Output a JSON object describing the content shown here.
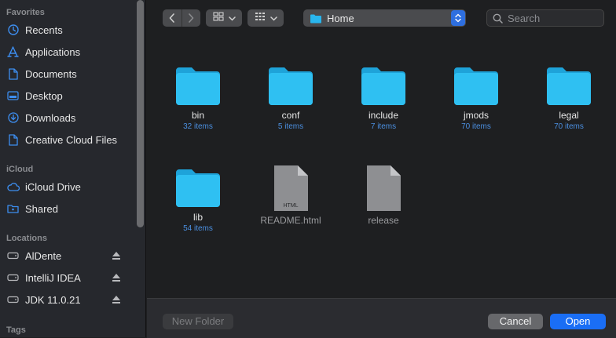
{
  "sidebar": {
    "favorites_label": "Favorites",
    "favorites": [
      {
        "label": "Recents",
        "icon": "clock-icon"
      },
      {
        "label": "Applications",
        "icon": "applications-icon"
      },
      {
        "label": "Documents",
        "icon": "document-icon"
      },
      {
        "label": "Desktop",
        "icon": "desktop-icon"
      },
      {
        "label": "Downloads",
        "icon": "download-icon"
      },
      {
        "label": "Creative Cloud Files",
        "icon": "file-icon"
      }
    ],
    "icloud_label": "iCloud",
    "icloud": [
      {
        "label": "iCloud Drive",
        "icon": "cloud-icon"
      },
      {
        "label": "Shared",
        "icon": "shared-folder-icon"
      }
    ],
    "locations_label": "Locations",
    "locations": [
      {
        "label": "AlDente",
        "icon": "drive-icon"
      },
      {
        "label": "IntelliJ IDEA",
        "icon": "drive-icon"
      },
      {
        "label": "JDK 11.0.21",
        "icon": "drive-icon"
      }
    ],
    "tags_label": "Tags",
    "accent_color": "#3d8ef0"
  },
  "toolbar": {
    "path": "Home",
    "search_placeholder": "Search"
  },
  "files": [
    {
      "name": "bin",
      "count": "32 items",
      "type": "folder"
    },
    {
      "name": "conf",
      "count": "5 items",
      "type": "folder"
    },
    {
      "name": "include",
      "count": "7 items",
      "type": "folder"
    },
    {
      "name": "jmods",
      "count": "70 items",
      "type": "folder"
    },
    {
      "name": "legal",
      "count": "70 items",
      "type": "folder"
    },
    {
      "name": "lib",
      "count": "54 items",
      "type": "folder"
    },
    {
      "name": "README.html",
      "badge": "HTML",
      "type": "document"
    },
    {
      "name": "release",
      "type": "document"
    }
  ],
  "footer": {
    "new_folder": "New Folder",
    "cancel": "Cancel",
    "open": "Open"
  },
  "colors": {
    "folder": "#29b6ee",
    "open_button": "#1a6ef5"
  }
}
